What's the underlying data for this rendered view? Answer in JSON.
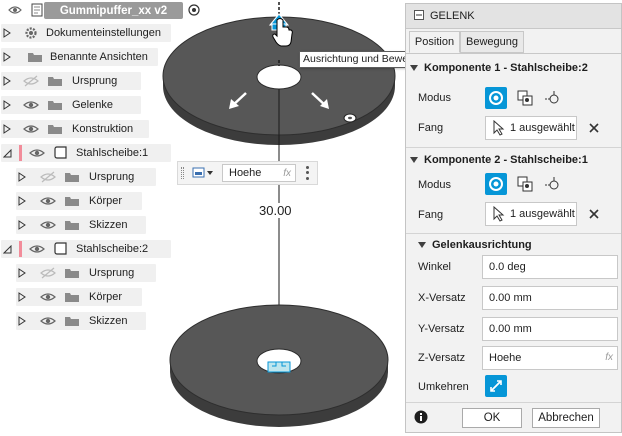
{
  "document": {
    "title": "Gummipuffer_xx v2"
  },
  "browser": {
    "items": [
      {
        "label": "Dokumenteinstellungen"
      },
      {
        "label": "Benannte Ansichten"
      },
      {
        "label": "Ursprung"
      },
      {
        "label": "Gelenke"
      },
      {
        "label": "Konstruktion"
      },
      {
        "label": "Stahlscheibe:1"
      },
      {
        "label": "Ursprung"
      },
      {
        "label": "Körper"
      },
      {
        "label": "Skizzen"
      },
      {
        "label": "Stahlscheibe:2"
      },
      {
        "label": "Ursprung"
      },
      {
        "label": "Körper"
      },
      {
        "label": "Skizzen"
      }
    ]
  },
  "viewport": {
    "tooltip": "Ausrichtung und Bewegung des Gelenks anpassen",
    "dimension_text": "30.00",
    "mini_toolbar": {
      "input_value": "Hoehe",
      "fx": "fx"
    }
  },
  "panel": {
    "title": "GELENK",
    "tabs": [
      {
        "label": "Position"
      },
      {
        "label": "Bewegung"
      }
    ],
    "component1": {
      "header": "Komponente 1 - Stahlscheibe:2",
      "mode_label": "Modus",
      "snap_label": "Fang",
      "snap_value": "1 ausgewählt"
    },
    "component2": {
      "header": "Komponente 2 - Stahlscheibe:1",
      "mode_label": "Modus",
      "snap_label": "Fang",
      "snap_value": "1 ausgewählt"
    },
    "alignment": {
      "header": "Gelenkausrichtung",
      "angle_label": "Winkel",
      "angle_value": "0.0 deg",
      "x_label": "X-Versatz",
      "x_value": "0.00 mm",
      "y_label": "Y-Versatz",
      "y_value": "0.00 mm",
      "z_label": "Z-Versatz",
      "z_value": "Hoehe",
      "fx": "fx",
      "flip_label": "Umkehren"
    },
    "footer": {
      "ok_label": "OK",
      "cancel_label": "Abbrechen"
    }
  },
  "colors": {
    "accent": "#0696d7",
    "disc_top": "#555555",
    "disc_side": "#3e3e3e",
    "pink": "#f28c9a",
    "title_gray": "#9a9a9a"
  }
}
